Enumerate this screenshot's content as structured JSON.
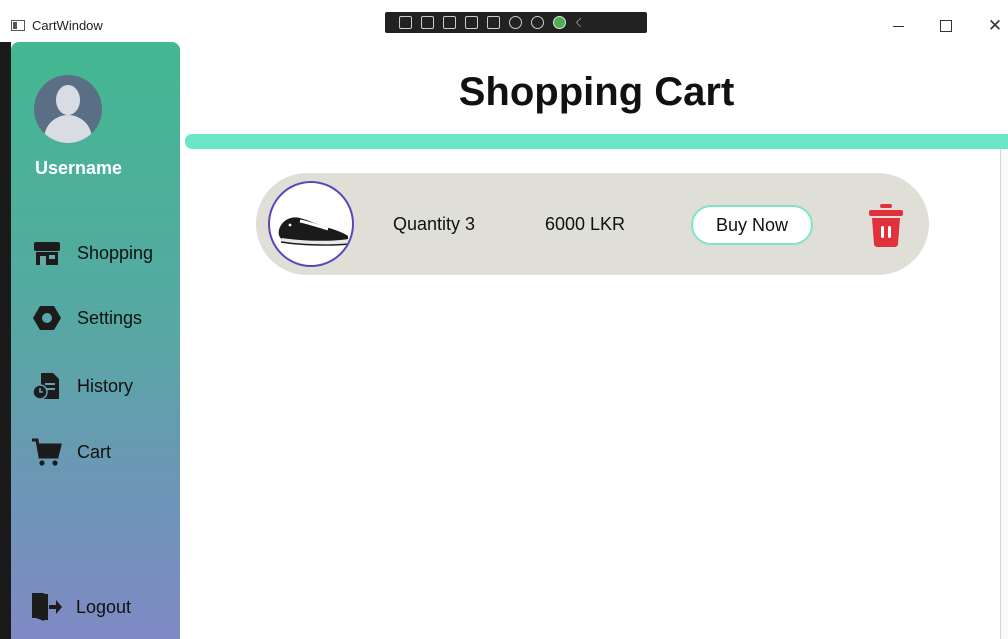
{
  "window": {
    "title": "CartWindow",
    "close_glyph": "✕"
  },
  "sidebar": {
    "username": "Username",
    "items": [
      {
        "label": "Shopping",
        "icon": "store-icon"
      },
      {
        "label": "Settings",
        "icon": "settings-hex-icon"
      },
      {
        "label": "History",
        "icon": "history-document-icon"
      },
      {
        "label": "Cart",
        "icon": "cart-icon"
      }
    ],
    "logout_label": "Logout"
  },
  "main": {
    "title": "Shopping Cart",
    "cart_items": [
      {
        "image": "sneaker-image",
        "quantity_text": "Quantity 3",
        "price_text": "6000 LKR",
        "buy_label": "Buy Now"
      }
    ]
  },
  "colors": {
    "sidebar_top": "#43b891",
    "sidebar_bottom": "#7f8ac4",
    "accent_rule": "#6ae7c8",
    "item_bg": "#dfdfd8",
    "thumb_border": "#5b45b8",
    "delete": "#e0313d"
  }
}
